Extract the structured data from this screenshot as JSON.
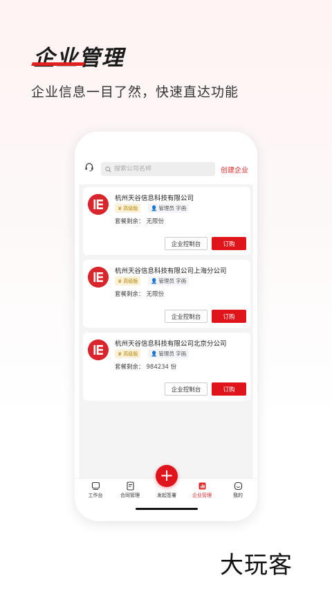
{
  "hero": {
    "title": "企业管理",
    "subtitle": "企业信息一目了然，快速直达功能"
  },
  "header": {
    "search_placeholder": "搜索公司名称",
    "create_label": "创建企业"
  },
  "companies": [
    {
      "name": "杭州天谷信息科技有限公司",
      "level": "高级版",
      "admin": "管理员 字画",
      "remaining_label": "套餐剩余：",
      "remaining_value": "无限份",
      "console_label": "企业控制台",
      "order_label": "订购"
    },
    {
      "name": "杭州天谷信息科技有限公司上海分公司",
      "level": "高级版",
      "admin": "管理员 字画",
      "remaining_label": "套餐剩余：",
      "remaining_value": "无限份",
      "console_label": "企业控制台",
      "order_label": "订购"
    },
    {
      "name": "杭州天谷信息科技有限公司北京分公司",
      "level": "高级版",
      "admin": "管理员 字画",
      "remaining_label": "套餐剩余：",
      "remaining_value": "984234 份",
      "console_label": "企业控制台",
      "order_label": "订购"
    }
  ],
  "tabs": [
    {
      "label": "工作台",
      "icon": "workbench-icon"
    },
    {
      "label": "合同管理",
      "icon": "contract-icon"
    },
    {
      "label": "发起签署",
      "icon": "plus-icon"
    },
    {
      "label": "企业管理",
      "icon": "enterprise-icon"
    },
    {
      "label": "我的",
      "icon": "profile-icon"
    }
  ],
  "watermark": "大玩客",
  "colors": {
    "accent": "#e0151c",
    "link": "#e02a2a",
    "badge_gold": "#b8860b"
  }
}
